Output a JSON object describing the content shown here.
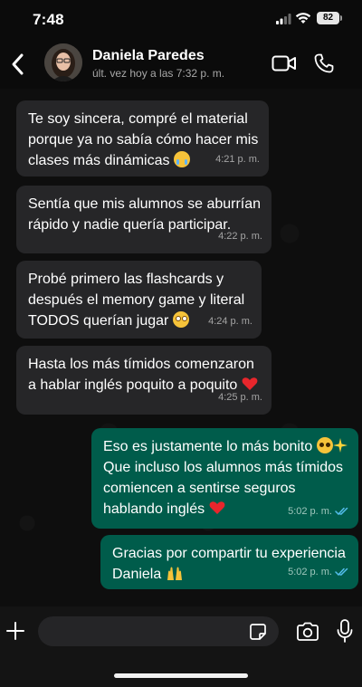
{
  "status_bar": {
    "time": "7:48",
    "battery": "82"
  },
  "header": {
    "contact_name": "Daniela Paredes",
    "last_seen": "últ. vez hoy a las 7:32 p. m."
  },
  "messages": [
    {
      "direction": "in",
      "text_lines": [
        "Te soy sincera, compré el material",
        "porque ya no sabía cómo hacer mis",
        "clases más dinámicas"
      ],
      "time": "4:21 p. m."
    },
    {
      "direction": "in",
      "text_lines": [
        "Sentía que mis alumnos se aburrían",
        "rápido y nadie quería participar."
      ],
      "time": "4:22 p. m."
    },
    {
      "direction": "in",
      "text_lines": [
        "Probé primero las flashcards y",
        "después el memory game y literal",
        "TODOS querían jugar"
      ],
      "time": "4:24 p. m."
    },
    {
      "direction": "in",
      "text_lines": [
        "Hasta los más tímidos comenzaron",
        "a hablar inglés poquito a poquito"
      ],
      "time": "4:25 p. m."
    },
    {
      "direction": "out",
      "text_lines": [
        "Eso es justamente lo más bonito",
        "Que incluso los alumnos más tímidos",
        "comiencen a sentirse seguros",
        "hablando inglés"
      ],
      "time": "5:02 p. m."
    },
    {
      "direction": "out",
      "text_lines": [
        "Gracias por compartir tu experiencia",
        "Daniela"
      ],
      "time": "5:02 p. m."
    }
  ],
  "icons": {
    "back": "chevron-left-icon",
    "video": "video-camera-icon",
    "call": "phone-icon",
    "attach": "plus-icon",
    "sticker": "sticker-icon",
    "camera": "camera-icon",
    "mic": "microphone-icon",
    "read_receipt": "double-check-icon"
  },
  "colors": {
    "incoming_bubble": "#262628",
    "outgoing_bubble": "#005c4b",
    "read_ticks": "#53bdeb"
  }
}
